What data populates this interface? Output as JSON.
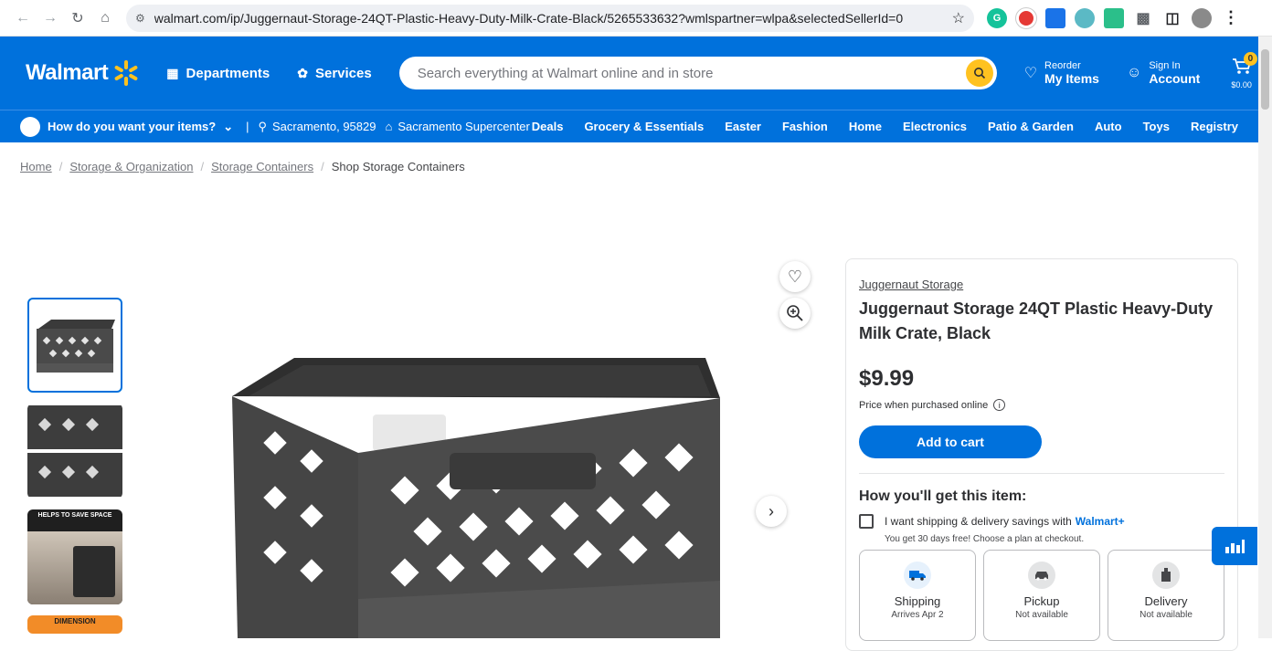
{
  "browser": {
    "url": "walmart.com/ip/Juggernaut-Storage-24QT-Plastic-Heavy-Duty-Milk-Crate-Black/5265533632?wmlspartner=wlpa&selectedSellerId=0"
  },
  "header": {
    "logo_text": "Walmart",
    "departments_label": "Departments",
    "services_label": "Services",
    "search_placeholder": "Search everything at Walmart online and in store",
    "reorder_small": "Reorder",
    "reorder_big": "My Items",
    "signin_small": "Sign In",
    "signin_big": "Account",
    "cart_count": "0",
    "cart_total": "$0.00"
  },
  "subnav": {
    "how_label": "How do you want your items?",
    "separator": "|",
    "location": "Sacramento, 95829",
    "store": "Sacramento Supercenter",
    "categories": [
      "Deals",
      "Grocery & Essentials",
      "Easter",
      "Fashion",
      "Home",
      "Electronics",
      "Patio & Garden",
      "Auto",
      "Toys",
      "Registry"
    ]
  },
  "breadcrumb": {
    "items": [
      "Home",
      "Storage & Organization",
      "Storage Containers"
    ],
    "current": "Shop Storage Containers",
    "separator": "/"
  },
  "gallery": {
    "thumb3_text": "HELPS TO SAVE SPACE",
    "thumb4_text": "DIMENSION"
  },
  "product": {
    "brand": "Juggernaut Storage",
    "title": "Juggernaut Storage 24QT Plastic Heavy-Duty Milk Crate, Black",
    "price": "$9.99",
    "price_note": "Price when purchased online",
    "add_to_cart": "Add to cart",
    "how_get": "How you'll get this item:",
    "shipping_savings": "I want shipping & delivery savings with",
    "walmart_plus": "Walmart+",
    "trial": "You get 30 days free! Choose a plan at checkout.",
    "options": [
      {
        "label": "Shipping",
        "sub": "Arrives Apr 2"
      },
      {
        "label": "Pickup",
        "sub": "Not available"
      },
      {
        "label": "Delivery",
        "sub": "Not available"
      }
    ]
  },
  "colors": {
    "brand_blue": "#0071dc",
    "spark_yellow": "#ffc220"
  }
}
